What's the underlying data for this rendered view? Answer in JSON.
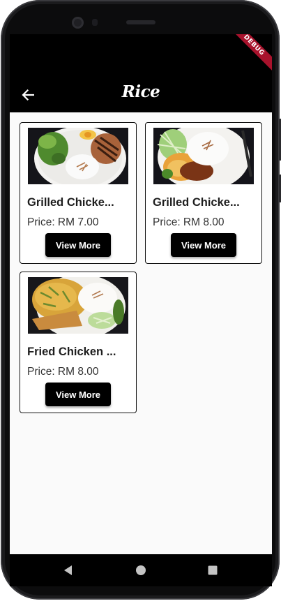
{
  "app": {
    "title": "Rice",
    "debug_label": "DEBUG"
  },
  "icons": {
    "back": "arrow-left-icon",
    "nav_back": "triangle-back-icon",
    "nav_home": "circle-home-icon",
    "nav_recents": "square-recents-icon"
  },
  "colors": {
    "appbar": "#000000",
    "background": "#fafafa",
    "button": "#000000",
    "debug_banner": "#a8122c"
  },
  "items": [
    {
      "name": "Grilled Chicke...",
      "price": "Price: RM 7.00",
      "button": "View More",
      "image": "grilled-chicken-rice-plate"
    },
    {
      "name": "Grilled Chicke...",
      "price": "Price: RM 8.00",
      "button": "View More",
      "image": "grilled-chicken-sauce-rice-plate"
    },
    {
      "name": "Fried Chicken ...",
      "price": "Price: RM 8.00",
      "button": "View More",
      "image": "fried-chicken-curry-rice-plate"
    }
  ]
}
